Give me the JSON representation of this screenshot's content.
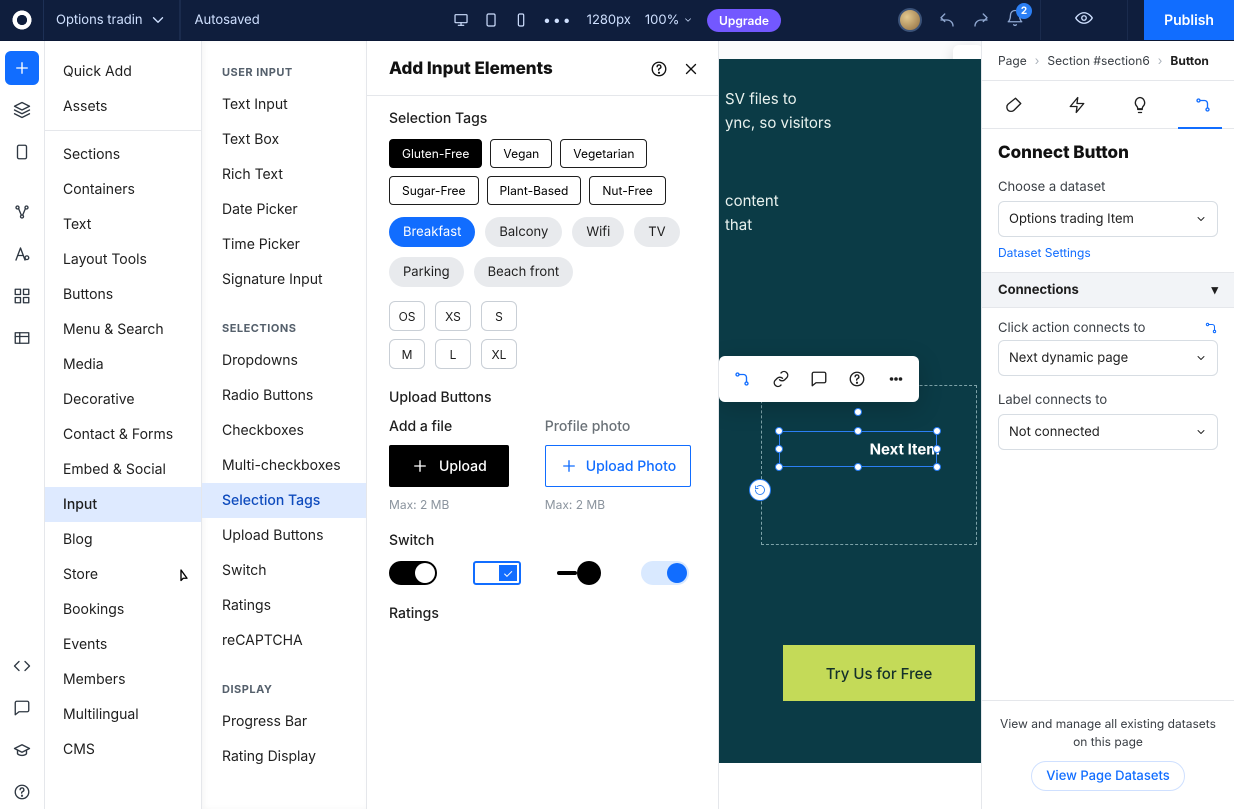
{
  "topbar": {
    "site_title": "Options tradin",
    "status": "Autosaved",
    "dimensions": "1280px",
    "zoom": "100%",
    "upgrade": "Upgrade",
    "notif_count": "2",
    "publish": "Publish"
  },
  "panel1": {
    "quick_add": "Quick Add",
    "assets": "Assets",
    "items": {
      "sections": "Sections",
      "containers": "Containers",
      "text": "Text",
      "layout": "Layout Tools",
      "buttons": "Buttons",
      "menu": "Menu & Search",
      "media": "Media",
      "decorative": "Decorative",
      "contact": "Contact & Forms",
      "embed": "Embed & Social",
      "input": "Input",
      "blog": "Blog",
      "store": "Store",
      "bookings": "Bookings",
      "events": "Events",
      "members": "Members",
      "multil": "Multilingual",
      "cms": "CMS"
    }
  },
  "panel2": {
    "hd_user_input": "USER INPUT",
    "user_input": {
      "text_input": "Text Input",
      "text_box": "Text Box",
      "rich_text": "Rich Text",
      "date_picker": "Date Picker",
      "time_picker": "Time Picker",
      "signature": "Signature Input"
    },
    "hd_selections": "SELECTIONS",
    "selections": {
      "dropdowns": "Dropdowns",
      "radio": "Radio Buttons",
      "checkboxes": "Checkboxes",
      "multi": "Multi-checkboxes",
      "selection_tags": "Selection Tags",
      "upload_buttons": "Upload Buttons",
      "switch": "Switch",
      "ratings": "Ratings",
      "recaptcha": "reCAPTCHA"
    },
    "hd_display": "DISPLAY",
    "display": {
      "progress": "Progress Bar",
      "rating_display": "Rating Display"
    }
  },
  "panel3": {
    "title": "Add Input Elements",
    "section_selection_tags": "Selection Tags",
    "tags1": [
      "Gluten-Free",
      "Vegan",
      "Vegetarian",
      "Sugar-Free",
      "Plant-Based",
      "Nut-Free"
    ],
    "pills": [
      "Breakfast",
      "Balcony",
      "Wifi",
      "TV",
      "Parking",
      "Beach front"
    ],
    "sizes1": [
      "OS",
      "XS",
      "S"
    ],
    "sizes2": [
      "M",
      "L",
      "XL"
    ],
    "section_upload": "Upload Buttons",
    "upload": {
      "add_file": "Add a file",
      "upload": "Upload",
      "profile": "Profile photo",
      "upload_photo": "Upload Photo",
      "hint1": "Max: 2 MB",
      "hint2": "Max: 2 MB"
    },
    "section_switch": "Switch",
    "section_ratings": "Ratings"
  },
  "canvas": {
    "line1": "SV files to",
    "line2": "ync, so visitors",
    "line3": "content",
    "line4": "that",
    "selected_label": "Next Item",
    "cta": "Try Us for Free"
  },
  "inspector": {
    "crumbs": {
      "page": "Page",
      "section": "Section #section6",
      "last": "Button"
    },
    "heading": "Connect Button",
    "choose_dataset": "Choose a dataset",
    "dataset_value": "Options trading Item",
    "dataset_settings": "Dataset Settings",
    "connections": "Connections",
    "click_action": "Click action connects to",
    "click_value": "Next dynamic page",
    "label_connects": "Label connects to",
    "label_value": "Not connected",
    "footer_text": "View and manage all existing datasets on this page",
    "footer_btn": "View Page Datasets"
  }
}
